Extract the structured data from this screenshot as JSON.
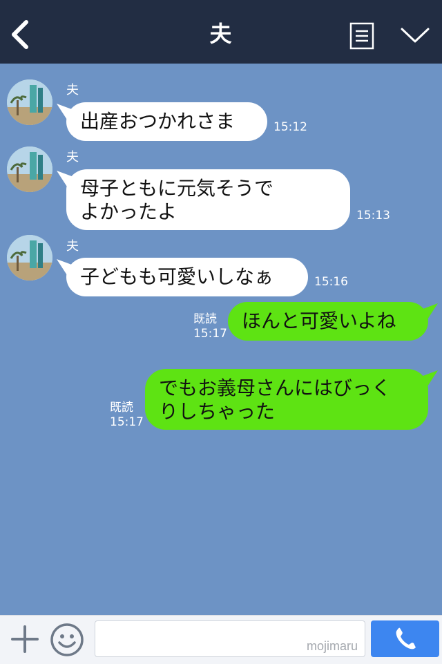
{
  "header": {
    "title": "夫",
    "back_icon": "chevron-left-icon",
    "menu_icon": "note-menu-icon",
    "dropdown_icon": "chevron-down-icon"
  },
  "messages": [
    {
      "direction": "in",
      "sender": "夫",
      "lines": [
        "出産おつかれさま"
      ],
      "time": "15:12"
    },
    {
      "direction": "in",
      "sender": "夫",
      "lines": [
        "母子ともに元気そうで",
        "よかったよ"
      ],
      "time": "15:13"
    },
    {
      "direction": "in",
      "sender": "夫",
      "lines": [
        "子どもも可愛いしなぁ"
      ],
      "time": "15:16"
    },
    {
      "direction": "out",
      "read": "既読",
      "lines": [
        "ほんと可愛いよね"
      ],
      "time": "15:17"
    },
    {
      "direction": "out",
      "read": "既読",
      "lines": [
        "でもお義母さんにはびっく",
        "りしちゃった"
      ],
      "time": "15:17"
    }
  ],
  "input": {
    "watermark": "mojimaru",
    "placeholder": ""
  },
  "colors": {
    "header_bg": "#222d43",
    "chat_bg": "#6d93c5",
    "outgoing_bubble": "#5ee313",
    "incoming_bubble": "#ffffff",
    "call_button": "#3d86f0"
  },
  "icons": {
    "plus": "plus-icon",
    "emoji": "smiley-icon",
    "call": "phone-icon"
  }
}
